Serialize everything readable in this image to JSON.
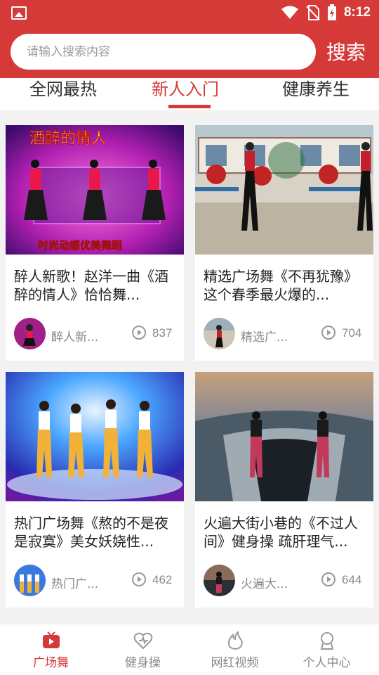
{
  "status": {
    "time": "8:12"
  },
  "search": {
    "placeholder": "请输入搜索内容",
    "button_label": "搜索"
  },
  "tabs": [
    {
      "label": "全网最热",
      "active": false
    },
    {
      "label": "新人入门",
      "active": true
    },
    {
      "label": "健康养生",
      "active": false
    }
  ],
  "videos": [
    {
      "title": "醉人新歌！赵洋一曲《酒醉的情人》恰恰舞...",
      "author": "醉人新...",
      "views": "837",
      "thumb_text_top": "酒醉的情人",
      "thumb_text_bottom": "时尚动感优美舞蹈"
    },
    {
      "title": "精选广场舞《不再犹豫》这个春季最火爆的...",
      "author": "精选广...",
      "views": "704"
    },
    {
      "title": "热门广场舞《熬的不是夜是寂寞》美女妖娆性...",
      "author": "热门广...",
      "views": "462"
    },
    {
      "title": "火遍大街小巷的《不过人间》健身操 疏肝理气...",
      "author": "火遍大...",
      "views": "644"
    }
  ],
  "bottom_nav": [
    {
      "label": "广场舞",
      "icon": "tv-icon",
      "active": true
    },
    {
      "label": "健身操",
      "icon": "heart-icon",
      "active": false
    },
    {
      "label": "网红视频",
      "icon": "fire-icon",
      "active": false
    },
    {
      "label": "个人中心",
      "icon": "user-icon",
      "active": false
    }
  ],
  "colors": {
    "brand": "#d63a38"
  }
}
